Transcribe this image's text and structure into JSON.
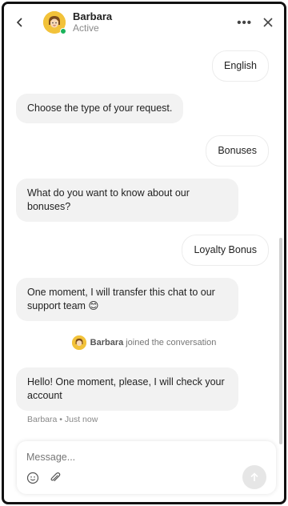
{
  "header": {
    "agent_name": "Barbara",
    "agent_status": "Active",
    "more_icon": "more-horizontal-icon",
    "close_icon": "close-icon",
    "back_icon": "chevron-left-icon"
  },
  "messages": [
    {
      "from": "user",
      "text": "English"
    },
    {
      "from": "agent",
      "text": "Choose the type of your request."
    },
    {
      "from": "user",
      "text": "Bonuses"
    },
    {
      "from": "agent",
      "text": "What do you want to know about our bonuses?"
    },
    {
      "from": "user",
      "text": "Loyalty Bonus"
    },
    {
      "from": "agent",
      "text": "One moment, I will transfer this chat to our support team 😊"
    },
    {
      "from": "agent",
      "text": "Hello! One moment, please, I will check your account"
    }
  ],
  "system": {
    "name": "Barbara",
    "text": "joined the conversation"
  },
  "last_meta": "Barbara • Just now",
  "composer": {
    "placeholder": "Message...",
    "emoji_icon": "emoji-icon",
    "attach_icon": "paperclip-icon",
    "send_icon": "arrow-up-icon"
  },
  "colors": {
    "avatar": "#f2c23a",
    "online": "#19b35b",
    "agent_bubble": "#f2f2f2"
  }
}
